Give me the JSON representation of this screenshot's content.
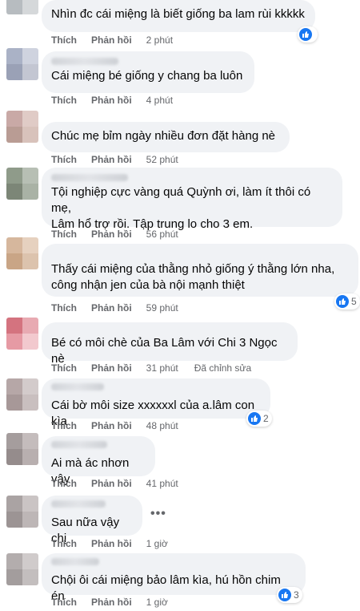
{
  "comments": [
    {
      "text": "Nhìn đc cái miệng là biết giống ba lam rùi kkkkk",
      "like": "Thích",
      "reply": "Phản hồi",
      "time": "2 phút",
      "reactions": ""
    },
    {
      "text": "Cái miệng bé giống y chang ba luôn",
      "like": "Thích",
      "reply": "Phản hồi",
      "time": "4 phút",
      "reactions": ""
    },
    {
      "text": "Chúc mẹ bỉm ngày nhiều đơn đặt hàng nè",
      "like": "Thích",
      "reply": "Phản hồi",
      "time": "52 phút",
      "reactions": ""
    },
    {
      "text": "Tội nghiệp cực vàng quá Quỳnh ơi, làm ít thôi có mẹ,\nLâm hổ trợ rồi. Tập trung lo cho 3 em.",
      "like": "Thích",
      "reply": "Phản hồi",
      "time": "56 phút",
      "reactions": ""
    },
    {
      "text": "Thấy cái miệng của thằng nhỏ giống ý thằng lớn nha,\ncông nhận jen của bà nội mạnh thiệt",
      "like": "Thích",
      "reply": "Phản hồi",
      "time": "59 phút",
      "reactions": "5"
    },
    {
      "text": "Bé có môi chè của Ba Lâm với Chi 3 Ngọc nè",
      "like": "Thích",
      "reply": "Phản hồi",
      "time": "31 phút",
      "edited": "Đã chỉnh sửa",
      "reactions": ""
    },
    {
      "text": "Cái bờ môi size xxxxxxl của a.lâm con kìa",
      "like": "Thích",
      "reply": "Phản hồi",
      "time": "48 phút",
      "reactions": "2"
    },
    {
      "text": "Ai mà ác nhơn vậy",
      "like": "Thích",
      "reply": "Phản hồi",
      "time": "41 phút",
      "reactions": ""
    },
    {
      "text": "Sau nữa vậy chị",
      "like": "Thích",
      "reply": "Phản hồi",
      "time": "1 giờ",
      "reactions": "",
      "more": "•••"
    },
    {
      "text": "Chội ôi cái miệng bảo lâm kìa, hú hồn chim én",
      "like": "Thích",
      "reply": "Phản hồi",
      "time": "1 giờ",
      "reactions": "3"
    }
  ],
  "icons": {
    "reaction": "like-icon",
    "more": "more-options-icon",
    "avatar": "avatar"
  },
  "colors": {
    "bubble": "#f0f2f5",
    "like_blue": "#1877f2",
    "meta": "#65676b",
    "text": "#050505"
  }
}
